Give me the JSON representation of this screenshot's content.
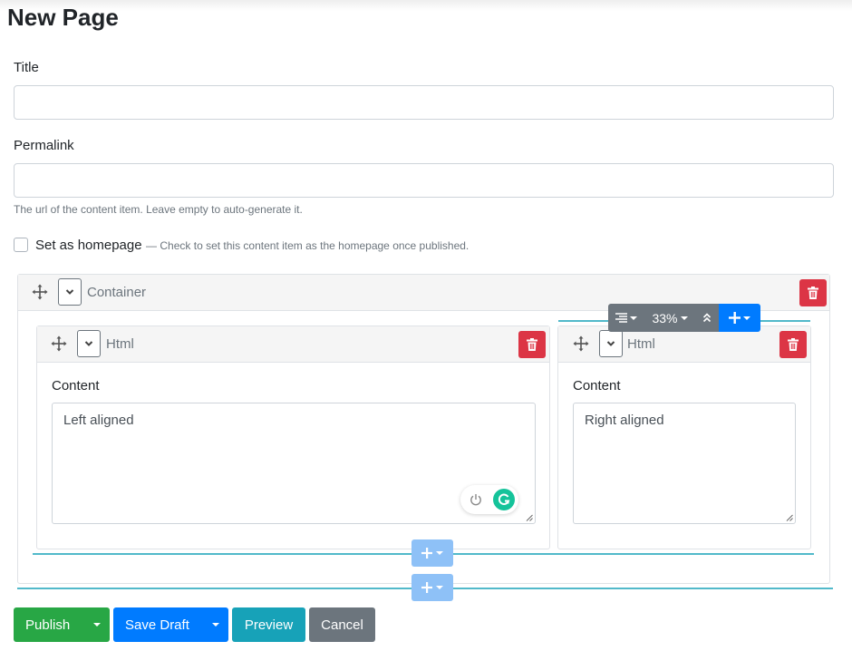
{
  "page": {
    "title": "New Page"
  },
  "form": {
    "title_label": "Title",
    "title_value": "",
    "permalink_label": "Permalink",
    "permalink_value": "",
    "permalink_help": "The url of the content item. Leave empty to auto-generate it.",
    "homepage_label": "Set as homepage",
    "homepage_hint": "— Check to set this content item as the homepage once published.",
    "homepage_checked": false
  },
  "container": {
    "name": "Container",
    "columns": [
      {
        "widget": "Html",
        "content_label": "Content",
        "content_value": "Left aligned"
      },
      {
        "widget": "Html",
        "content_label": "Content",
        "content_value": "Right aligned"
      }
    ]
  },
  "column_toolbar": {
    "width_label": "33%"
  },
  "actions": {
    "publish": "Publish",
    "save_draft": "Save Draft",
    "preview": "Preview",
    "cancel": "Cancel"
  },
  "colors": {
    "success": "#28a745",
    "primary": "#007bff",
    "info": "#17a2b8",
    "secondary": "#6c757d",
    "danger": "#dc3545",
    "grammarly": "#15c39a"
  }
}
